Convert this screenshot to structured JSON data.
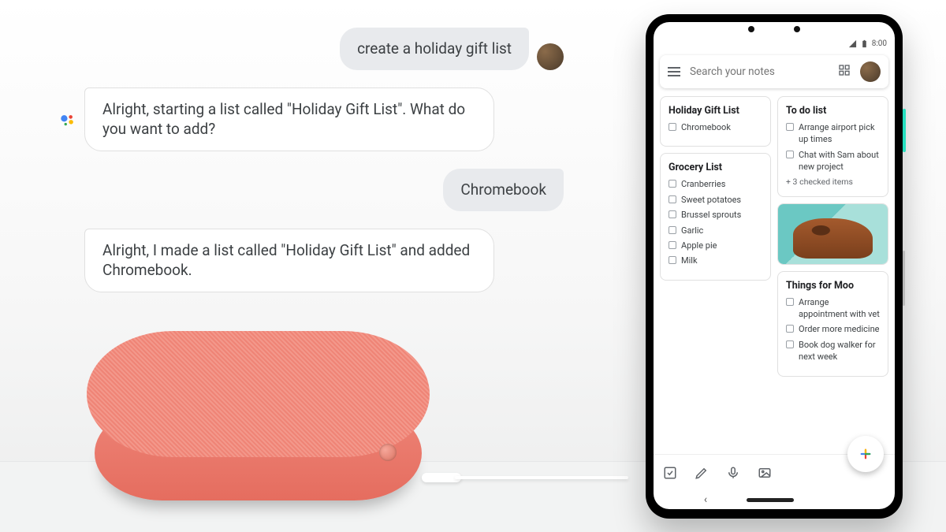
{
  "chat": {
    "user1": "create a holiday gift list",
    "assist1": "Alright, starting a list called \"Holiday Gift List\". What do you want to add?",
    "user2": "Chromebook",
    "assist2": "Alright, I made a list called \"Holiday Gift List\" and added Chromebook."
  },
  "status": {
    "time": "8:00"
  },
  "search": {
    "placeholder": "Search your notes"
  },
  "notes": {
    "holiday": {
      "title": "Holiday Gift List",
      "items": [
        "Chromebook"
      ]
    },
    "grocery": {
      "title": "Grocery List",
      "items": [
        "Cranberries",
        "Sweet potatoes",
        "Brussel sprouts",
        "Garlic",
        "Apple pie",
        "Milk"
      ]
    },
    "todo": {
      "title": "To do list",
      "items": [
        "Arrange airport pick up times",
        "Chat with Sam about new project"
      ],
      "more": "+ 3 checked items"
    },
    "moo": {
      "title": "Things for Moo",
      "items": [
        "Arrange appointment with vet",
        "Order more medicine",
        "Book dog walker for next week"
      ]
    }
  }
}
